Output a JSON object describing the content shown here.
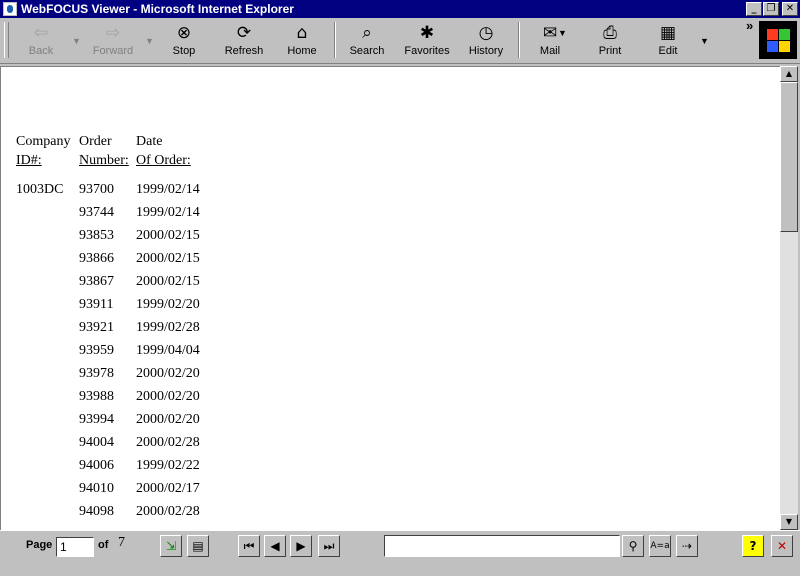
{
  "window": {
    "title": "WebFOCUS Viewer - Microsoft Internet Explorer"
  },
  "toolbar": {
    "back": "Back",
    "forward": "Forward",
    "stop": "Stop",
    "refresh": "Refresh",
    "home": "Home",
    "search": "Search",
    "favorites": "Favorites",
    "history": "History",
    "mail": "Mail",
    "print": "Print",
    "edit": "Edit",
    "chevron": "»"
  },
  "report": {
    "headers": {
      "company_line1": "Company",
      "company_line2": "ID#:",
      "order_line1": "Order",
      "order_line2": "Number:",
      "date_line1": "Date",
      "date_line2": "Of Order:"
    },
    "company": "1003DC",
    "rows": [
      {
        "order": "93700",
        "date": "1999/02/14"
      },
      {
        "order": "93744",
        "date": "1999/02/14"
      },
      {
        "order": "93853",
        "date": "2000/02/15"
      },
      {
        "order": "93866",
        "date": "2000/02/15"
      },
      {
        "order": "93867",
        "date": "2000/02/15"
      },
      {
        "order": "93911",
        "date": "1999/02/20"
      },
      {
        "order": "93921",
        "date": "1999/02/28"
      },
      {
        "order": "93959",
        "date": "1999/04/04"
      },
      {
        "order": "93978",
        "date": "2000/02/20"
      },
      {
        "order": "93988",
        "date": "2000/02/20"
      },
      {
        "order": "93994",
        "date": "2000/02/20"
      },
      {
        "order": "94004",
        "date": "2000/02/28"
      },
      {
        "order": "94006",
        "date": "1999/02/22"
      },
      {
        "order": "94010",
        "date": "2000/02/17"
      },
      {
        "order": "94098",
        "date": "2000/02/28"
      }
    ]
  },
  "viewer": {
    "page_label": "Page",
    "page_value": "1",
    "of_label": "of",
    "total_pages": "7",
    "search_value": "",
    "case_button": "A=a"
  },
  "colors": {
    "titlebar": "#000080",
    "chrome": "#c0c0c0",
    "help_button": "#ffff00",
    "close_x": "#c00000"
  }
}
